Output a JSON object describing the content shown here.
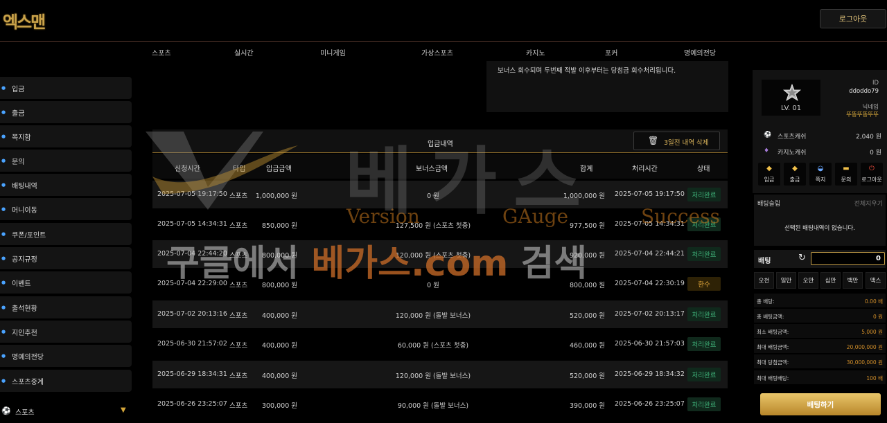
{
  "logo": "엑스맨",
  "header": {
    "logout": "로그아웃"
  },
  "topnav": [
    "스포츠",
    "실시간",
    "미니게임",
    "가상스포츠",
    "카지노",
    "포커",
    "명예의전당"
  ],
  "sidebar": {
    "items": [
      "입금",
      "출금",
      "쪽지함",
      "문의",
      "배팅내역",
      "머니이동",
      "쿠폰/포인트",
      "공지규정",
      "이벤트",
      "출석현황",
      "지인추천",
      "명예의전당",
      "스포츠중계"
    ],
    "sports": "스포츠"
  },
  "notice": "보너스 회수되며 두번째 적발 이후부터는 당첨금 회수처리됩니다.",
  "deposit_panel": {
    "title": "입금내역",
    "delete_button": "3일전 내역 삭제",
    "columns": [
      "신청시간",
      "타입",
      "입금금액",
      "보너스금액",
      "합계",
      "처리시간",
      "상태"
    ],
    "rows": [
      [
        "2025-07-05 19:17:50",
        "스포츠",
        "1,000,000 원",
        "0 원",
        "1,000,000 원",
        "2025-07-05 19:17:50",
        "처리완료"
      ],
      [
        "2025-07-05 14:34:31",
        "스포츠",
        "850,000 원",
        "127,500 원 (스포츠 첫충)",
        "977,500 원",
        "2025-07-05 14:34:31",
        "처리완료"
      ],
      [
        "2025-07-04 22:44:20",
        "스포츠",
        "800,000 원",
        "120,000 원 (스포츠 첫충)",
        "920,000 원",
        "2025-07-04 22:44:21",
        "처리완료"
      ],
      [
        "2025-07-04 22:29:00",
        "스포츠",
        "800,000 원",
        "0 원",
        "800,000 원",
        "2025-07-04 22:30:19",
        "환수"
      ],
      [
        "2025-07-02 20:13:16",
        "스포츠",
        "400,000 원",
        "120,000 원 (돌발 보너스)",
        "520,000 원",
        "2025-07-02 20:13:17",
        "처리완료"
      ],
      [
        "2025-06-30 21:57:02",
        "스포츠",
        "400,000 원",
        "60,000 원 (스포츠 첫충)",
        "460,000 원",
        "2025-06-30 21:57:03",
        "처리완료"
      ],
      [
        "2025-06-29 18:34:31",
        "스포츠",
        "400,000 원",
        "120,000 원 (돌발 보너스)",
        "520,000 원",
        "2025-06-29 18:34:32",
        "처리완료"
      ],
      [
        "2025-06-26 23:25:07",
        "스포츠",
        "300,000 원",
        "90,000 원 (돌발 보너스)",
        "390,000 원",
        "2025-06-26 23:25:07",
        "처리완료"
      ]
    ]
  },
  "watermark": {
    "big": "베가스",
    "words": [
      "Version",
      "GAuge",
      "Success"
    ],
    "line_a": "구글에서 ",
    "line_b": "베가스.com",
    "line_c": " 검색"
  },
  "user": {
    "level": "LV. 01",
    "id_label": "ID",
    "id": "ddoddo79",
    "nick_label": "닉네임",
    "nick": "뚜똥뚜똥뚜뚜",
    "sports_cash_label": "스포츠캐쉬",
    "sports_cash": "2,040 원",
    "casino_cash_label": "카지노캐쉬",
    "casino_cash": "0 원",
    "quick": [
      "입금",
      "출금",
      "쪽지",
      "문의",
      "로그아웃"
    ]
  },
  "betslip": {
    "title": "배팅슬립",
    "clear": "전체지우기",
    "empty": "선택된 배팅내역이 없습니다."
  },
  "bet": {
    "label": "배팅",
    "value": "0",
    "amounts": [
      "오천",
      "일만",
      "오만",
      "십만",
      "백만",
      "맥스"
    ],
    "info": [
      [
        "총 배당:",
        "0.00 배"
      ],
      [
        "총 배팅금액:",
        "0 원"
      ],
      [
        "최소 배팅금액:",
        "5,000 원"
      ],
      [
        "최대 배팅금액:",
        "20,000,000 원"
      ],
      [
        "최대 당첨금액:",
        "30,000,000 원"
      ],
      [
        "최대 배팅배당:",
        "100 배"
      ]
    ],
    "submit": "배팅하기"
  },
  "colors": {
    "accent": "#c9a24a",
    "done": "#3fb37a",
    "cancel": "#e3a83a"
  }
}
